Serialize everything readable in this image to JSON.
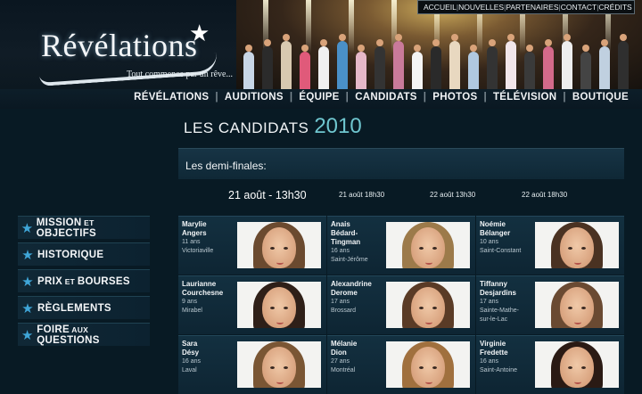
{
  "brand": {
    "logo_text": "Révélations",
    "tagline": "Tout commence par un rêve..."
  },
  "utility_nav": [
    "ACCUEIL",
    "NOUVELLES",
    "PARTENAIRES",
    "CONTACT",
    "CRÉDITS"
  ],
  "main_nav": [
    "RÉVÉLATIONS",
    "AUDITIONS",
    "ÉQUIPE",
    "CANDIDATS",
    "PHOTOS",
    "TÉLÉVISION",
    "BOUTIQUE"
  ],
  "page": {
    "title": "LES CANDIDATS",
    "year": "2010",
    "section": "Les demi-finales:"
  },
  "date_tabs": [
    {
      "label": "21 août - 13h30",
      "active": true
    },
    {
      "label": "21 août 18h30",
      "active": false
    },
    {
      "label": "22 août 13h30",
      "active": false
    },
    {
      "label": "22 août 18h30",
      "active": false
    }
  ],
  "sidebar": [
    {
      "big1": "MISSION",
      "small": "ET",
      "big2": "OBJECTIFS"
    },
    {
      "big1": "HISTORIQUE",
      "small": "",
      "big2": ""
    },
    {
      "big1": "PRIX",
      "small": "ET",
      "big2": "BOURSES"
    },
    {
      "big1": "RÈGLEMENTS",
      "small": "",
      "big2": ""
    },
    {
      "big1": "FOIRE",
      "small": "AUX",
      "big2": "QUESTIONS"
    }
  ],
  "candidates": [
    {
      "name_lines": [
        "Marylie",
        "Angers"
      ],
      "age": "11 ans",
      "city_lines": [
        "Victoriaville"
      ],
      "hair_color": "#6b4a2f"
    },
    {
      "name_lines": [
        "Anais",
        "Bédard-",
        "Tingman"
      ],
      "age": "16 ans",
      "city_lines": [
        "Saint-Jérôme"
      ],
      "hair_color": "#9c7a4a"
    },
    {
      "name_lines": [
        "Noémie",
        "Bélanger"
      ],
      "age": "10 ans",
      "city_lines": [
        "Saint-Constant"
      ],
      "hair_color": "#4a3222"
    },
    {
      "name_lines": [
        "Laurianne",
        "Courchesne"
      ],
      "age": "9 ans",
      "city_lines": [
        "Mirabel"
      ],
      "hair_color": "#2e1f18"
    },
    {
      "name_lines": [
        "Alexandrine",
        "Derome"
      ],
      "age": "17 ans",
      "city_lines": [
        "Brossard"
      ],
      "hair_color": "#5a3b26"
    },
    {
      "name_lines": [
        "Tiffanny",
        "Desjardins"
      ],
      "age": "17 ans",
      "city_lines": [
        "Sainte-Mathe-",
        "sur-le-Lac"
      ],
      "hair_color": "#6a4a32"
    },
    {
      "name_lines": [
        "Sara",
        "Désy"
      ],
      "age": "16 ans",
      "city_lines": [
        "Laval"
      ],
      "hair_color": "#7a5634"
    },
    {
      "name_lines": [
        "Mélanie",
        "Dion"
      ],
      "age": "27 ans",
      "city_lines": [
        "Montréal"
      ],
      "hair_color": "#a0703e"
    },
    {
      "name_lines": [
        "Virginie",
        "Fredette"
      ],
      "age": "16 ans",
      "city_lines": [
        "Saint-Antoine"
      ],
      "hair_color": "#2a1a14"
    }
  ]
}
